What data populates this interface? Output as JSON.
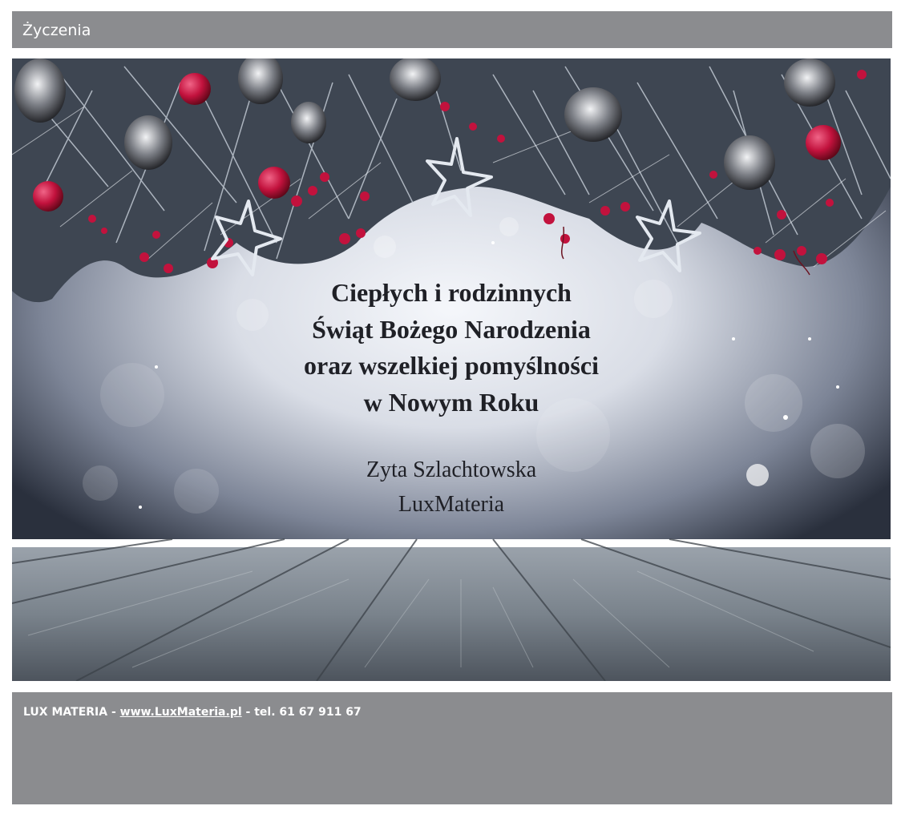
{
  "header": {
    "title": "Życzenia"
  },
  "card": {
    "greeting_lines": [
      "Ciepłych i rodzinnych",
      "Świąt Bożego Narodzenia",
      "oraz wszelkiej pomyślności",
      "w Nowym Roku"
    ],
    "signature_lines": [
      "Zyta Szlachtowska",
      "LuxMateria"
    ],
    "colors": {
      "berry": "#c2123d",
      "bokeh": "#f4f6fa",
      "wood": "#7f8890"
    }
  },
  "footer": {
    "company": "LUX MATERIA",
    "sep1": " - ",
    "link_text": "www.LuxMateria.pl",
    "sep2": " - ",
    "phone_text": "tel. 61 67 911 67"
  }
}
